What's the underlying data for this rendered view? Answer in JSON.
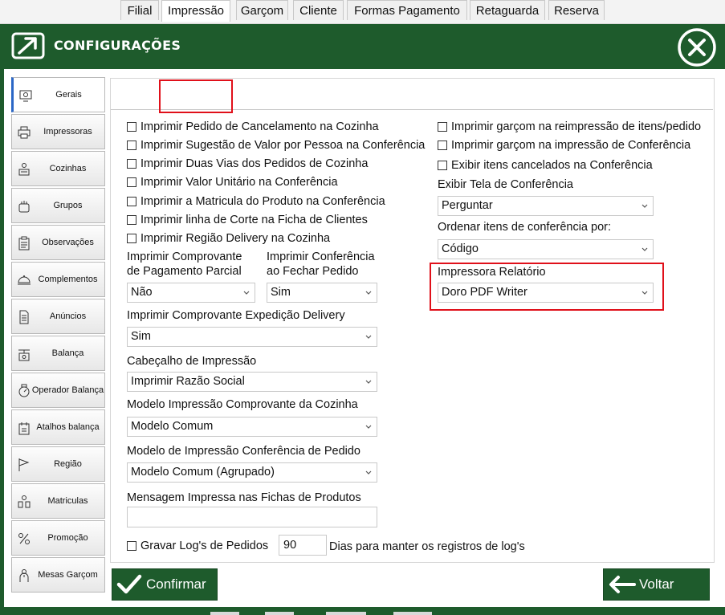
{
  "header": {
    "title": "CONFIGURAÇÕES"
  },
  "sidebar": {
    "items": [
      {
        "label": "Gerais",
        "icon": "gear-monitor-icon"
      },
      {
        "label": "Impressoras",
        "icon": "printer-icon"
      },
      {
        "label": "Cozinhas",
        "icon": "kitchen-icon"
      },
      {
        "label": "Grupos",
        "icon": "groups-icon"
      },
      {
        "label": "Observações",
        "icon": "clipboard-icon"
      },
      {
        "label": "Complementos",
        "icon": "dish-icon"
      },
      {
        "label": "Anúncios",
        "icon": "document-icon"
      },
      {
        "label": "Balança",
        "icon": "scale-icon"
      },
      {
        "label": "Operador  Balança",
        "icon": "scale-operator-icon"
      },
      {
        "label": "Atalhos balança",
        "icon": "shortcut-icon"
      },
      {
        "label": "Região",
        "icon": "flag-icon"
      },
      {
        "label": "Matriculas",
        "icon": "registrations-icon"
      },
      {
        "label": "Promoção",
        "icon": "promotion-icon"
      },
      {
        "label": "Mesas Garçom",
        "icon": "waiter-icon"
      }
    ]
  },
  "tabs": [
    "Filial",
    "Impressão",
    "Garçom",
    "Cliente",
    "Formas Pagamento",
    "Retaguarda",
    "Reserva"
  ],
  "left": {
    "checks": [
      "Imprimir Pedido de Cancelamento na Cozinha",
      "Imprimir Sugestão de Valor por Pessoa na Conferência",
      "Imprimir Duas Vias dos Pedidos de Cozinha",
      "Imprimir Valor Unitário na Conferência",
      "Imprimir a Matricula do Produto na Conferência",
      "Imprimir linha de Corte na Ficha de Clientes",
      "Imprimir Região Delivery na Cozinha"
    ],
    "comprovante_parcial": {
      "label_line1": "Imprimir Comprovante",
      "label_line2": "de Pagamento Parcial",
      "value": "Não"
    },
    "conferencia_fechar": {
      "label_line1": "Imprimir Conferência",
      "label_line2": "ao Fechar Pedido",
      "value": "Sim"
    },
    "expedicao": {
      "label": "Imprimir Comprovante Expedição Delivery",
      "value": "Sim"
    },
    "cabecalho": {
      "label": "Cabeçalho de Impressão",
      "value": "Imprimir Razão Social"
    },
    "modelo_cozinha": {
      "label": "Modelo Impressão Comprovante da Cozinha",
      "value": "Modelo Comum"
    },
    "modelo_conferencia": {
      "label": "Modelo de Impressão Conferência de Pedido",
      "value": "Modelo Comum (Agrupado)"
    },
    "mensagem": {
      "label": "Mensagem Impressa nas Fichas de Produtos",
      "value": ""
    },
    "log": {
      "label": "Gravar Log's de Pedidos",
      "days": "90",
      "suffix": "Dias para manter os registros de log's"
    }
  },
  "right": {
    "checks": [
      "Imprimir garçom na reimpressão de itens/pedido",
      "Imprimir garçom na impressão de Conferência",
      "Exibir itens cancelados na Conferência"
    ],
    "exibir_tela": {
      "label": "Exibir Tela de Conferência",
      "value": "Perguntar"
    },
    "ordenar": {
      "label": "Ordenar itens de conferência por:",
      "value": "Código"
    },
    "impressora": {
      "label": "Impressora Relatório",
      "value": "Doro PDF Writer"
    }
  },
  "buttons": {
    "confirm": "Confirmar",
    "back": "Voltar"
  },
  "colors": {
    "brand_green": "#1e5b2c",
    "highlight_red": "#e0101a",
    "active_blue": "#2b67c6"
  }
}
